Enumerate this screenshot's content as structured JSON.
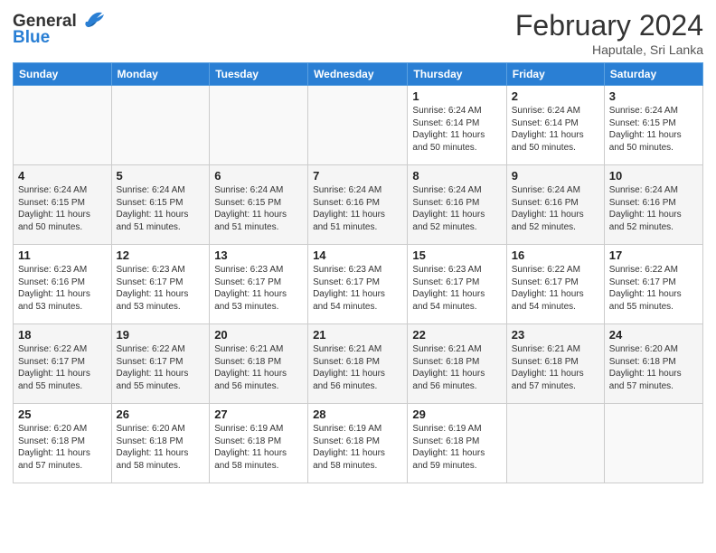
{
  "header": {
    "logo_general": "General",
    "logo_blue": "Blue",
    "title": "February 2024",
    "location": "Haputale, Sri Lanka"
  },
  "days_of_week": [
    "Sunday",
    "Monday",
    "Tuesday",
    "Wednesday",
    "Thursday",
    "Friday",
    "Saturday"
  ],
  "weeks": [
    [
      {
        "day": "",
        "info": ""
      },
      {
        "day": "",
        "info": ""
      },
      {
        "day": "",
        "info": ""
      },
      {
        "day": "",
        "info": ""
      },
      {
        "day": "1",
        "info": "Sunrise: 6:24 AM\nSunset: 6:14 PM\nDaylight: 11 hours\nand 50 minutes."
      },
      {
        "day": "2",
        "info": "Sunrise: 6:24 AM\nSunset: 6:14 PM\nDaylight: 11 hours\nand 50 minutes."
      },
      {
        "day": "3",
        "info": "Sunrise: 6:24 AM\nSunset: 6:15 PM\nDaylight: 11 hours\nand 50 minutes."
      }
    ],
    [
      {
        "day": "4",
        "info": "Sunrise: 6:24 AM\nSunset: 6:15 PM\nDaylight: 11 hours\nand 50 minutes."
      },
      {
        "day": "5",
        "info": "Sunrise: 6:24 AM\nSunset: 6:15 PM\nDaylight: 11 hours\nand 51 minutes."
      },
      {
        "day": "6",
        "info": "Sunrise: 6:24 AM\nSunset: 6:15 PM\nDaylight: 11 hours\nand 51 minutes."
      },
      {
        "day": "7",
        "info": "Sunrise: 6:24 AM\nSunset: 6:16 PM\nDaylight: 11 hours\nand 51 minutes."
      },
      {
        "day": "8",
        "info": "Sunrise: 6:24 AM\nSunset: 6:16 PM\nDaylight: 11 hours\nand 52 minutes."
      },
      {
        "day": "9",
        "info": "Sunrise: 6:24 AM\nSunset: 6:16 PM\nDaylight: 11 hours\nand 52 minutes."
      },
      {
        "day": "10",
        "info": "Sunrise: 6:24 AM\nSunset: 6:16 PM\nDaylight: 11 hours\nand 52 minutes."
      }
    ],
    [
      {
        "day": "11",
        "info": "Sunrise: 6:23 AM\nSunset: 6:16 PM\nDaylight: 11 hours\nand 53 minutes."
      },
      {
        "day": "12",
        "info": "Sunrise: 6:23 AM\nSunset: 6:17 PM\nDaylight: 11 hours\nand 53 minutes."
      },
      {
        "day": "13",
        "info": "Sunrise: 6:23 AM\nSunset: 6:17 PM\nDaylight: 11 hours\nand 53 minutes."
      },
      {
        "day": "14",
        "info": "Sunrise: 6:23 AM\nSunset: 6:17 PM\nDaylight: 11 hours\nand 54 minutes."
      },
      {
        "day": "15",
        "info": "Sunrise: 6:23 AM\nSunset: 6:17 PM\nDaylight: 11 hours\nand 54 minutes."
      },
      {
        "day": "16",
        "info": "Sunrise: 6:22 AM\nSunset: 6:17 PM\nDaylight: 11 hours\nand 54 minutes."
      },
      {
        "day": "17",
        "info": "Sunrise: 6:22 AM\nSunset: 6:17 PM\nDaylight: 11 hours\nand 55 minutes."
      }
    ],
    [
      {
        "day": "18",
        "info": "Sunrise: 6:22 AM\nSunset: 6:17 PM\nDaylight: 11 hours\nand 55 minutes."
      },
      {
        "day": "19",
        "info": "Sunrise: 6:22 AM\nSunset: 6:17 PM\nDaylight: 11 hours\nand 55 minutes."
      },
      {
        "day": "20",
        "info": "Sunrise: 6:21 AM\nSunset: 6:18 PM\nDaylight: 11 hours\nand 56 minutes."
      },
      {
        "day": "21",
        "info": "Sunrise: 6:21 AM\nSunset: 6:18 PM\nDaylight: 11 hours\nand 56 minutes."
      },
      {
        "day": "22",
        "info": "Sunrise: 6:21 AM\nSunset: 6:18 PM\nDaylight: 11 hours\nand 56 minutes."
      },
      {
        "day": "23",
        "info": "Sunrise: 6:21 AM\nSunset: 6:18 PM\nDaylight: 11 hours\nand 57 minutes."
      },
      {
        "day": "24",
        "info": "Sunrise: 6:20 AM\nSunset: 6:18 PM\nDaylight: 11 hours\nand 57 minutes."
      }
    ],
    [
      {
        "day": "25",
        "info": "Sunrise: 6:20 AM\nSunset: 6:18 PM\nDaylight: 11 hours\nand 57 minutes."
      },
      {
        "day": "26",
        "info": "Sunrise: 6:20 AM\nSunset: 6:18 PM\nDaylight: 11 hours\nand 58 minutes."
      },
      {
        "day": "27",
        "info": "Sunrise: 6:19 AM\nSunset: 6:18 PM\nDaylight: 11 hours\nand 58 minutes."
      },
      {
        "day": "28",
        "info": "Sunrise: 6:19 AM\nSunset: 6:18 PM\nDaylight: 11 hours\nand 58 minutes."
      },
      {
        "day": "29",
        "info": "Sunrise: 6:19 AM\nSunset: 6:18 PM\nDaylight: 11 hours\nand 59 minutes."
      },
      {
        "day": "",
        "info": ""
      },
      {
        "day": "",
        "info": ""
      }
    ]
  ]
}
